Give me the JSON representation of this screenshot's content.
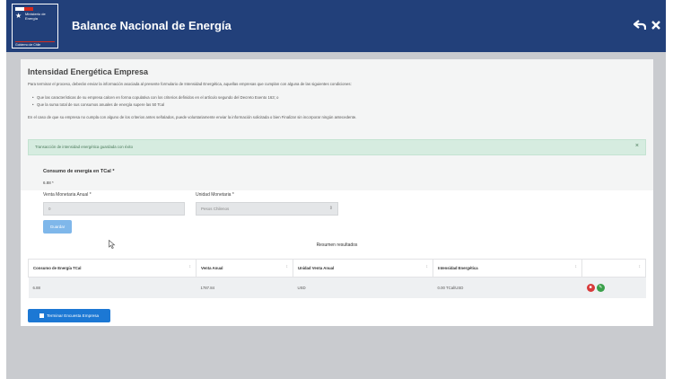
{
  "header": {
    "logo_line1": "Ministerio de Energía",
    "logo_line2": "Gobierno de Chile",
    "title": "Balance Nacional de Energía"
  },
  "page": {
    "title": "Intensidad Energética Empresa",
    "intro": "Para terminar el proceso, deberán enviar la información asociada al presente formulario de Intensidad Energética, aquellas empresas que cumplan con alguna de las siguientes condiciones:",
    "conditions": [
      {
        "text": "Que las características de su empresa calcen en forma copulativa con los criterios definidos en el artículo segundo del Decreto Exento ",
        "link": "163",
        "suffix": "; o"
      },
      {
        "text": "Que la suma total de sus consumos anuales de energía supere las 50 Tcal"
      }
    ],
    "note": "En el caso de que su empresa no cumpla con alguno de los criterios antes señalados, puede voluntariamente enviar la información solicitada o bien Finalizar sin incorporar ningún antecedente."
  },
  "alert": {
    "text": "Transacción de intensidad energética guardada con éxito",
    "close": "×"
  },
  "form": {
    "consumo_label": "Consumo de energía en TCal *",
    "consumo_value": "6.88 *",
    "venta_label": "Venta Monetaria Anual *",
    "venta_value": "0",
    "unidad_label": "Unidad Monetaria *",
    "unidad_value": "Pesos Chilenos",
    "guardar": "Guardar"
  },
  "summary": {
    "title": "Resumen resultados",
    "columns": [
      "Consumo de Energía TCal",
      "Venta Anual",
      "Unidad Venta Anual",
      "Intensidad Energética",
      ""
    ],
    "rows": [
      [
        "6.88",
        "1787.84",
        "USD",
        "0.00 TCal/USD"
      ]
    ]
  },
  "footer": {
    "terminar": "Terminar Encuesta Empresa"
  },
  "icons": {
    "back": "back-arrow-icon",
    "close": "close-icon",
    "delete": "trash-icon",
    "edit": "edit-icon"
  },
  "colors": {
    "header": "#22407a",
    "primary": "#1c78d4",
    "success_bg": "#d6ece0",
    "danger": "#d83a3a",
    "edit": "#3aa04a"
  }
}
